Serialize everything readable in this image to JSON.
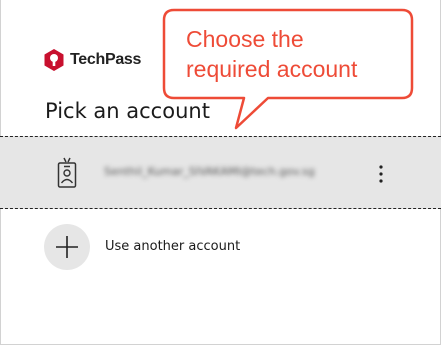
{
  "brand": {
    "name": "TechPass",
    "accent": "#c8102e"
  },
  "page": {
    "title": "Pick an account"
  },
  "accounts": [
    {
      "email": "Senthil_Kumar_SIVAKAMI@tech.gov.sg",
      "icon": "id-badge-icon",
      "more_icon": "more-vertical-icon"
    }
  ],
  "use_another": {
    "label": "Use another account",
    "icon": "plus-icon"
  },
  "callout": {
    "line1": "Choose the",
    "line2": "required account",
    "color": "#ee4b37"
  }
}
